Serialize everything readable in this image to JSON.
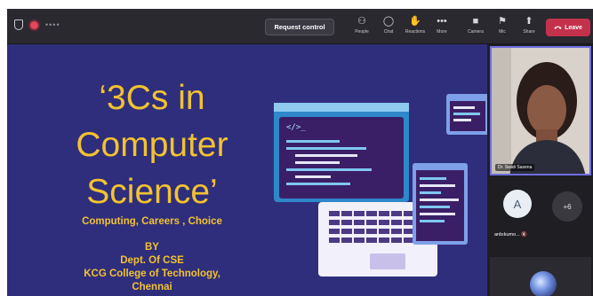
{
  "toolbar": {
    "time": "••••",
    "request_control": "Request control",
    "items": [
      {
        "icon": "people-icon",
        "glyph": "⚇",
        "label": "People"
      },
      {
        "icon": "chat-icon",
        "glyph": "◯",
        "label": "Chat"
      },
      {
        "icon": "reactions-icon",
        "glyph": "✋",
        "label": "Reactions"
      },
      {
        "icon": "more-icon",
        "glyph": "•••",
        "label": "More"
      }
    ],
    "right_items": [
      {
        "icon": "camera-icon",
        "glyph": "■",
        "label": "Camera"
      },
      {
        "icon": "mic-icon",
        "glyph": "⚑",
        "label": "Mic"
      },
      {
        "icon": "share-icon",
        "glyph": "⬆",
        "label": "Share"
      }
    ],
    "leave": "Leave",
    "leave_color": "#c4314b"
  },
  "slide": {
    "title": "‘3Cs in Computer Science’",
    "subtitle": "Computing, Careers , Choice",
    "by": "BY",
    "dept": "Dept. Of CSE",
    "college": "KCG College of Technology,",
    "city": "Chennai",
    "background": "#2f2e7c",
    "accent": "#f2c230"
  },
  "participants": {
    "presenter_name": "Dr. Swati Saxena",
    "attendee_initial": "A",
    "attendee_name": "anbıkumo...",
    "overflow_label": "+6"
  }
}
